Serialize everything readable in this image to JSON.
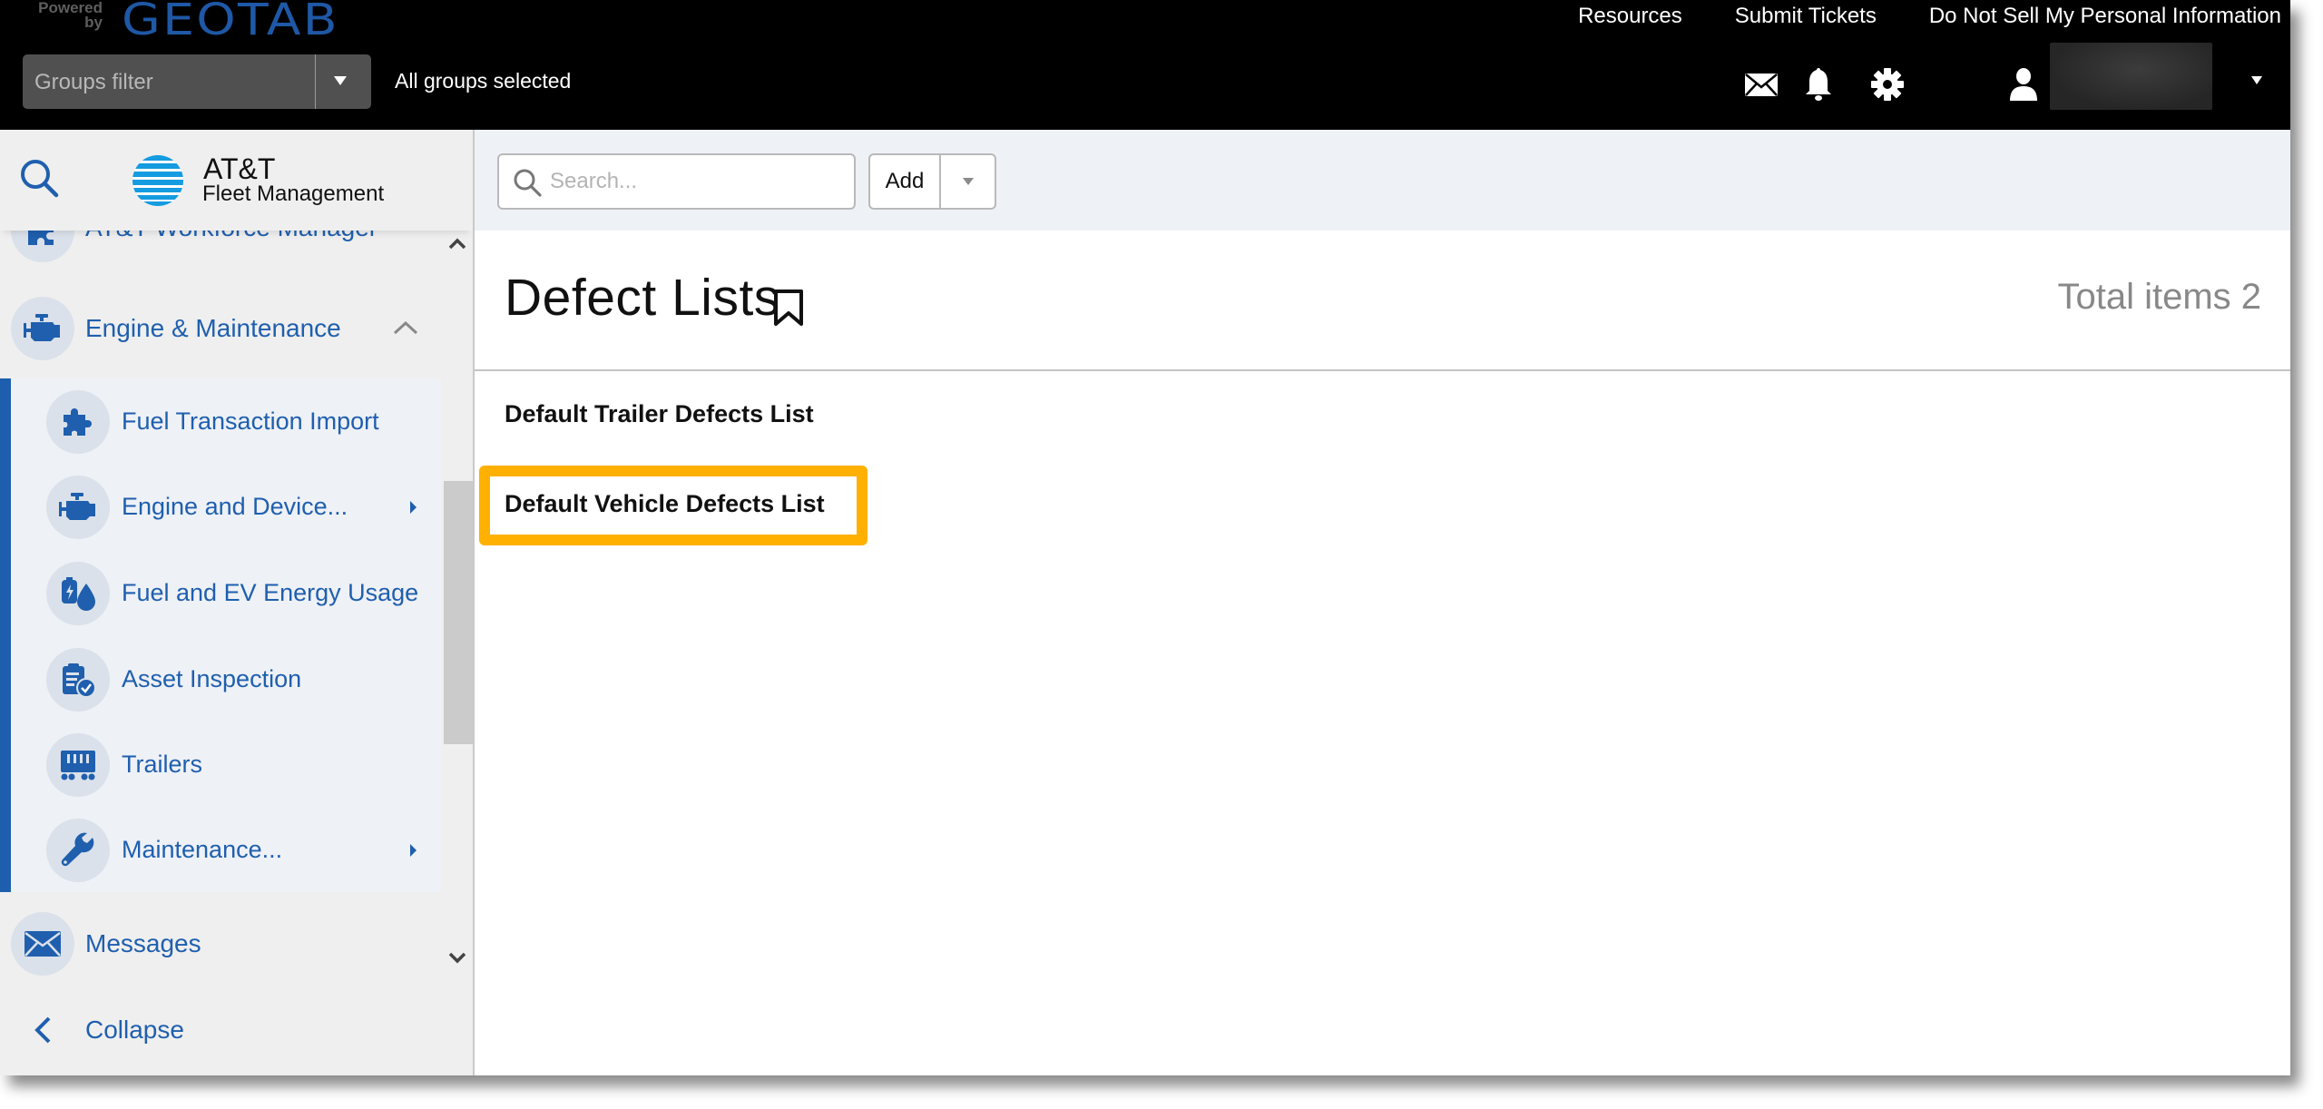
{
  "header": {
    "powered_by": "Powered by",
    "brand": "GEOTAB",
    "groups_filter_placeholder": "Groups filter",
    "groups_status": "All groups selected",
    "links": [
      "Resources",
      "Submit Tickets",
      "Do Not Sell My Personal Information"
    ],
    "icons": [
      "mail-icon",
      "bell-icon",
      "gear-icon",
      "user-icon"
    ]
  },
  "sidebar": {
    "logo_title": "AT&T",
    "logo_subtitle": "Fleet Management",
    "partial_item": "AT&T Workforce Manager",
    "section": {
      "label": "Engine & Maintenance",
      "expanded": true
    },
    "sub_items": [
      {
        "label": "Fuel Transaction Import",
        "icon": "puzzle-icon",
        "has_submenu": false
      },
      {
        "label": "Engine and Device...",
        "icon": "engine-icon",
        "has_submenu": true
      },
      {
        "label": "Fuel and EV Energy Usage",
        "icon": "fuel-ev-icon",
        "has_submenu": false
      },
      {
        "label": "Asset Inspection",
        "icon": "clipboard-check-icon",
        "has_submenu": false
      },
      {
        "label": "Trailers",
        "icon": "trailer-icon",
        "has_submenu": false
      },
      {
        "label": "Maintenance...",
        "icon": "wrench-icon",
        "has_submenu": true
      }
    ],
    "messages": "Messages",
    "collapse": "Collapse"
  },
  "main": {
    "search_placeholder": "Search...",
    "add_label": "Add",
    "title": "Defect Lists",
    "total_items": "Total items 2",
    "items": [
      "Default Trailer Defects List",
      "Default Vehicle Defects List"
    ],
    "highlighted_index": 1
  },
  "colors": {
    "accent_blue": "#1f5fae",
    "highlight": "#ffb000",
    "header_bg": "#000000"
  }
}
